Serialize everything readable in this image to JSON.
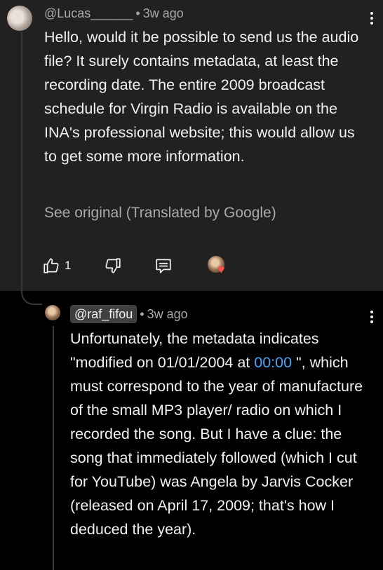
{
  "top_comment": {
    "author": "@Lucas______",
    "separator": "•",
    "time": "3w ago",
    "text": "Hello, would it be possible to send us the audio file? It surely contains metadata, at least the recording date. The entire 2009 broadcast schedule for Virgin Radio is available on the INA's professional website; this would allow us to get some more information.",
    "see_original": "See original (Translated by Google)",
    "like_count": "1",
    "icons": [
      "thumb-up-icon",
      "thumb-down-icon",
      "reply-icon",
      "creator-heart-icon",
      "more-vert-icon"
    ]
  },
  "reply": {
    "author": "@raf_fifou",
    "separator": "•",
    "time": "3w ago",
    "text_before_link": "Unfortunately, the metadata indicates \"modified on 01/01/2004 at ",
    "timestamp_link": "00:00",
    "text_after_link": " \", which must correspond to the year of manufacture of the small MP3 player/ radio on which I recorded the song. But I have a clue: the song that immediately followed (which I cut for YouTube) was Angela by Jarvis Cocker (released on April 17, 2009; that's how I deduced the year).",
    "icons": [
      "more-vert-icon"
    ]
  },
  "colors": {
    "top_background": "#212121",
    "reply_background": "#000000",
    "link": "#3ea6ff",
    "heart": "#ff4e45",
    "secondary_text": "#aaaaaa"
  }
}
